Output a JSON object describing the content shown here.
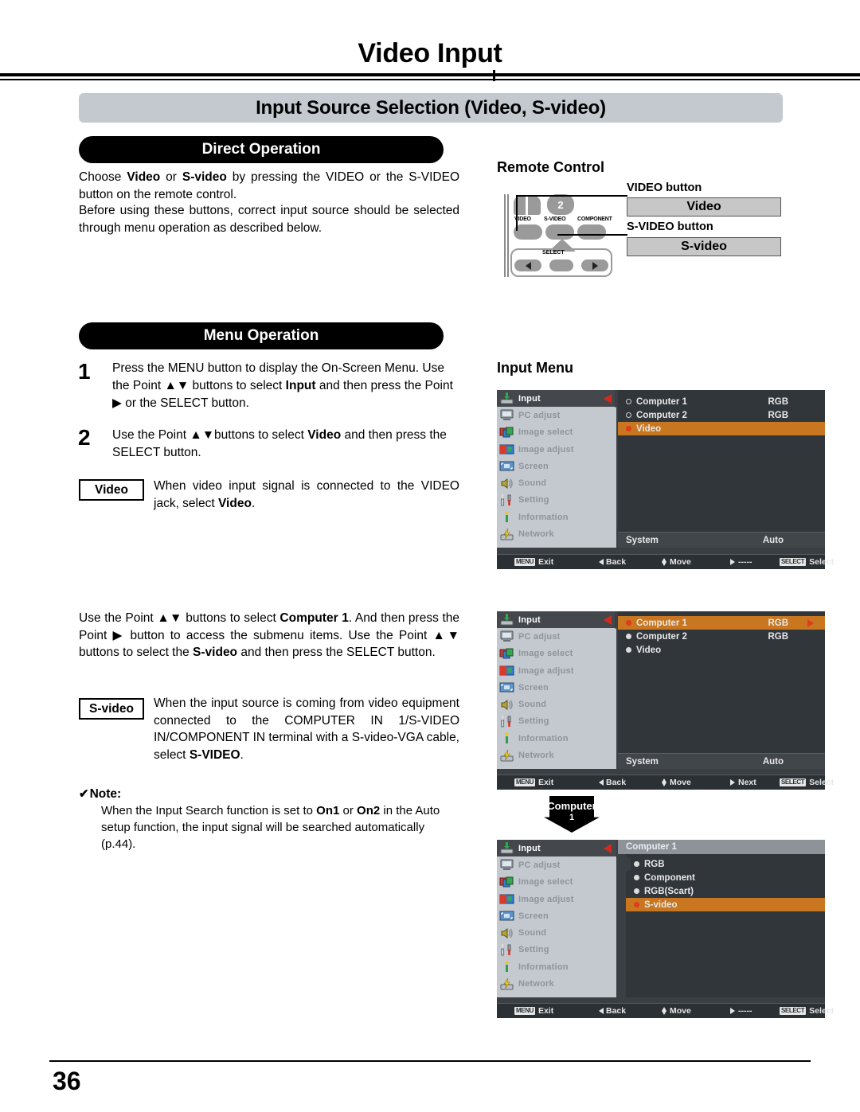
{
  "page": {
    "title": "Video Input",
    "section_banner": "Input Source Selection (Video, S-video)",
    "number": "36"
  },
  "direct_operation": {
    "heading": "Direct Operation",
    "paragraph_1_html": "Choose <b>Video</b> or <b>S-video</b> by pressing the VIDEO or the S-VIDEO button on the remote control.",
    "paragraph_2_html": "Before using these buttons, correct input source should be selected through menu operation as described below."
  },
  "remote_control": {
    "heading": "Remote Control",
    "video_button_label": "VIDEO button",
    "svideo_button_label": "S-VIDEO button",
    "video_box": "Video",
    "svideo_box": "S-video",
    "keys": {
      "number_badge": "2",
      "video": "VIDEO",
      "s_video": "S-VIDEO",
      "component": "COMPONENT",
      "select": "SELECT"
    }
  },
  "menu_operation": {
    "heading": "Menu Operation",
    "steps": [
      {
        "number": "1",
        "text_html": "Press the MENU button to display the On-Screen Menu. Use the Point ▲▼ buttons to select <b>Input</b> and then press the Point ▶ or the SELECT button."
      },
      {
        "number": "2",
        "text_html": "Use the Point ▲▼buttons to select <b>Video</b> and then press the SELECT button."
      }
    ],
    "video_term": "Video",
    "video_definition_html": "When video input signal is connected to the VIDEO jack, select <b>Video</b>.",
    "middle_paragraph_html": "Use the Point ▲▼ buttons to select <b>Computer 1</b>. And then press the Point ▶ button to access the submenu items. Use the Point ▲▼ buttons to select the <b>S-video</b> and then press the SELECT button.",
    "svideo_term": "S-video",
    "svideo_definition_html": "When the input source is coming from video equipment connected to the COMPUTER IN 1/S-VIDEO IN/COMPONENT IN terminal with a S-video-VGA cable, select <b>S-VIDEO</b>."
  },
  "note": {
    "check": "✔",
    "heading": "Note:",
    "text_html": "When the Input Search function is set to <b>On1</b> or <b>On2</b> in the Auto setup function, the input signal will be searched automatically (p.44)."
  },
  "input_menu": {
    "heading": "Input Menu",
    "sidebar": [
      {
        "label": "Input",
        "icon": "input-icon"
      },
      {
        "label": "PC adjust",
        "icon": "pc-adjust-icon"
      },
      {
        "label": "Image select",
        "icon": "image-select-icon"
      },
      {
        "label": "Image adjust",
        "icon": "image-adjust-icon"
      },
      {
        "label": "Screen",
        "icon": "screen-icon"
      },
      {
        "label": "Sound",
        "icon": "sound-icon"
      },
      {
        "label": "Setting",
        "icon": "setting-icon"
      },
      {
        "label": "Information",
        "icon": "information-icon"
      },
      {
        "label": "Network",
        "icon": "network-icon"
      }
    ],
    "screens": [
      {
        "id": "osd-video-selected",
        "options": [
          {
            "label": "Computer 1",
            "value": "RGB",
            "bullet": "open",
            "highlighted": false
          },
          {
            "label": "Computer 2",
            "value": "RGB",
            "bullet": "open",
            "highlighted": false
          },
          {
            "label": "Video",
            "value": "",
            "bullet": "fill-r",
            "highlighted": true
          }
        ],
        "system_key": "System",
        "system_value": "Auto",
        "footer": {
          "exit_key": "MENU",
          "exit": "Exit",
          "back": "Back",
          "move": "Move",
          "next": "-----",
          "select_key": "SELECT",
          "select": "Select"
        }
      },
      {
        "id": "osd-computer1-selected",
        "options": [
          {
            "label": "Computer 1",
            "value": "RGB",
            "bullet": "fill-r",
            "highlighted": true,
            "show_next_arrow": true
          },
          {
            "label": "Computer 2",
            "value": "RGB",
            "bullet": "fill-w",
            "highlighted": false
          },
          {
            "label": "Video",
            "value": "",
            "bullet": "fill-w",
            "highlighted": false
          }
        ],
        "system_key": "System",
        "system_value": "Auto",
        "footer": {
          "exit_key": "MENU",
          "exit": "Exit",
          "back": "Back",
          "move": "Move",
          "next": "Next",
          "select_key": "SELECT",
          "select": "Select"
        }
      },
      {
        "id": "osd-computer1-submenu",
        "submenu_title": "Computer 1",
        "options": [
          {
            "label": "RGB",
            "value": "",
            "bullet": "fill-w",
            "highlighted": false
          },
          {
            "label": "Component",
            "value": "",
            "bullet": "fill-w",
            "highlighted": false
          },
          {
            "label": "RGB(Scart)",
            "value": "",
            "bullet": "fill-w",
            "highlighted": false
          },
          {
            "label": "S-video",
            "value": "",
            "bullet": "fill-r",
            "highlighted": true
          }
        ],
        "footer": {
          "exit_key": "MENU",
          "exit": "Exit",
          "back": "Back",
          "move": "Move",
          "next": "-----",
          "select_key": "SELECT",
          "select": "Select"
        }
      }
    ]
  },
  "computer_callout": {
    "line1": "Computer",
    "line2": "1"
  },
  "colors": {
    "banner_gray": "#c3c9ce",
    "highlight_orange": "#c8761f",
    "osd_panel": "#31363b",
    "osd_frame": "#3a3f44",
    "caret_red": "#d42a1e",
    "gray_button": "#c7c7c7"
  }
}
